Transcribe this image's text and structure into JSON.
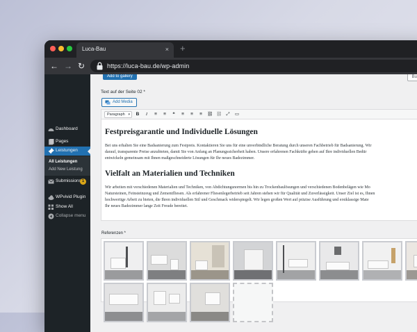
{
  "browser": {
    "tab_title": "Luca-Bau",
    "tab_close": "×",
    "new_tab": "+",
    "url": "https://luca-bau.de/wp-admin"
  },
  "sidebar": {
    "items": [
      {
        "label": "Dashboard",
        "icon": "dashboard-icon"
      },
      {
        "label": "Pages",
        "icon": "pages-icon"
      },
      {
        "label": "Leistungen",
        "icon": "pin-icon",
        "active": true
      },
      {
        "label": "Submissions",
        "icon": "envelope-icon",
        "badge": "1"
      },
      {
        "label": "WPvivid Plugin",
        "icon": "cloud-icon"
      },
      {
        "label": "Show All",
        "icon": "grid-icon"
      },
      {
        "label": "Collapse menu",
        "icon": "collapse-icon"
      }
    ],
    "submenu": [
      "All Leistungen",
      "Add New Leistung"
    ]
  },
  "content": {
    "add_to_gallery": "Add to gallery",
    "bulk_button": "Bulk actions",
    "field_label": "Text auf der Seite 02 *",
    "add_media": "Add Media",
    "format_select": "Paragraph",
    "toolbar_buttons": [
      "B",
      "I",
      "≡",
      "≡",
      "❝",
      "≡",
      "≡",
      "≡",
      "⛓",
      "⛓",
      "⤢",
      "▭"
    ],
    "heading1": "Festpreisgarantie und Individuelle Lösungen",
    "para1": [
      "Bei uns erhalten Sie eine Badsanierung zum Festpreis. Kontaktieren Sie uns für eine unverbindliche Beratung durch unseren Fachbetrieb für Badsanierung. Wir",
      "darauf, transparente Preise anzubieten, damit Sie von Anfang an Planungssicherheit haben. Unsere erfahrenen Fachkräfte gehen auf Ihre individuellen Bedür",
      "entwickeln gemeinsam mit Ihnen maßgeschneiderte Lösungen für Ihr neues Badezimmer."
    ],
    "heading2": "Vielfalt an Materialien und Techniken",
    "para2": [
      "Wir arbeiten mit verschiedenen Materialien und Techniken, von Abdichtungsnormen bis hin zu Trockenbaulösungen und verschiedenen Bodenbelägen wie Mo",
      "Natursteinen, Feinsteinzeug und Zementfliesen. Als erfahrener Fliesenlegerbetrieb seit Jahren stehen wir für Qualität und Zuverlässigkeit. Unser Ziel ist es, Ihnen",
      "hochwertige Arbeit zu bieten, die Ihren individuellen Stil und Geschmack widerspiegelt. Wir legen großen Wert auf präzise Ausführung und erstklassige Mate",
      "Ihr neues Badezimmer lange Zeit Freude bereitet."
    ],
    "ref_label": "Referenzen *"
  }
}
